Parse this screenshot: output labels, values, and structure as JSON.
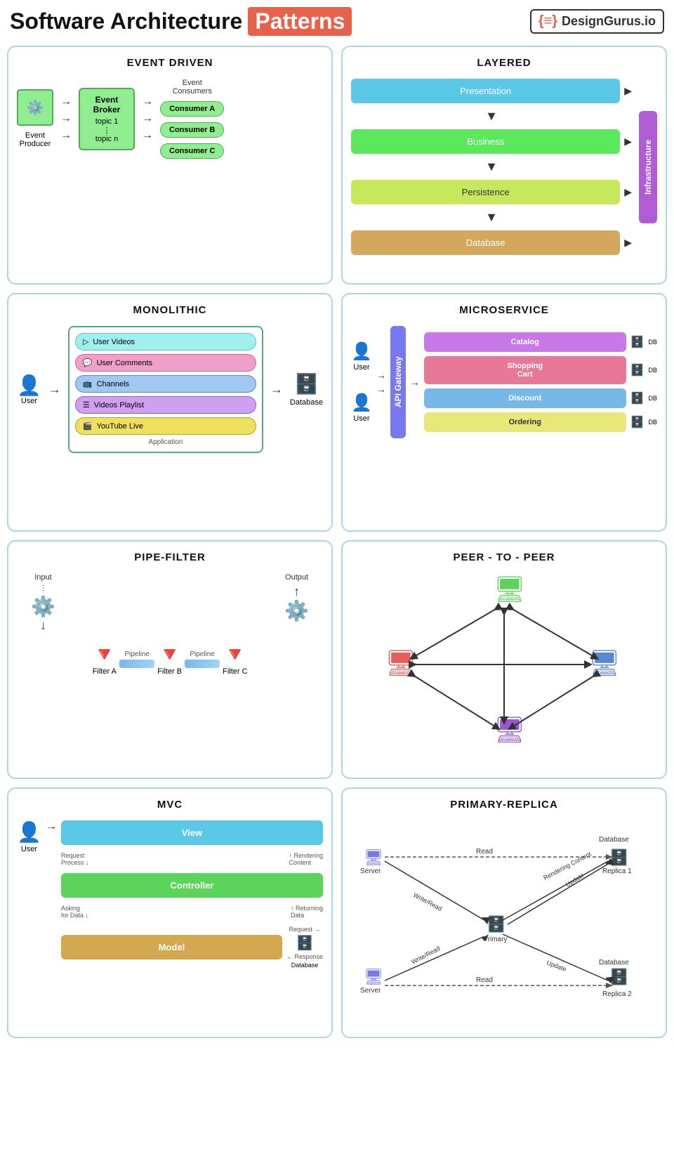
{
  "header": {
    "title_normal": "Software Architecture",
    "title_highlight": "Patterns",
    "logo_text": "DesignGurus.io",
    "logo_symbol": "{≡}"
  },
  "patterns": {
    "event_driven": {
      "title": "EVENT DRIVEN",
      "producer_label": "Event\nProducer",
      "broker_title": "Event\nBroker",
      "broker_topics": "topic 1\n⋮\ntopic n",
      "consumers_label": "Event\nConsumers",
      "consumers": [
        "Consumer A",
        "Consumer B",
        "Consumer C"
      ]
    },
    "layered": {
      "title": "LAYERED",
      "layers": [
        "Presentation",
        "Business",
        "Persistence",
        "Database"
      ],
      "infra": "Infrastructure"
    },
    "monolithic": {
      "title": "MONOLITHIC",
      "items": [
        "User Videos",
        "User Comments",
        "Channels",
        "Videos Playlist",
        "YouTube Live"
      ],
      "app_label": "Application",
      "user_label": "User",
      "db_label": "Database"
    },
    "microservice": {
      "title": "MICROSERVICE",
      "gateway": "API Gateway",
      "user_label": "User",
      "services": [
        "Catalog",
        "Shopping\nCart",
        "Discount",
        "Ordering"
      ],
      "db_label": "DB"
    },
    "pipe_filter": {
      "title": "PIPE-FILTER",
      "input_label": "Input",
      "output_label": "Output",
      "filters": [
        "Filter A",
        "Filter B",
        "Filter C"
      ],
      "pipeline_label": "Pipeline"
    },
    "peer_to_peer": {
      "title": "PEER - TO - PEER"
    },
    "mvc": {
      "title": "MVC",
      "user_label": "User",
      "view_label": "View",
      "controller_label": "Controller",
      "model_label": "Model",
      "db_label": "Database",
      "labels": {
        "request": "Request\nProcess",
        "rendering": "Rendering\nContent",
        "asking": "Asking\nfor Data",
        "returning": "Returning\nData",
        "request2": "Request",
        "response": "Response"
      }
    },
    "primary_replica": {
      "title": "PRIMARY-REPLICA",
      "server_label": "Server",
      "primary_label": "Primary",
      "replica1_label": "Replica 1",
      "replica2_label": "Replica 2",
      "db1_label": "Database",
      "db2_label": "Database",
      "labels": {
        "read": "Read",
        "write_read": "Write/Read",
        "rendering": "Rendering\nContent",
        "update": "Update",
        "read2": "Read"
      }
    }
  }
}
